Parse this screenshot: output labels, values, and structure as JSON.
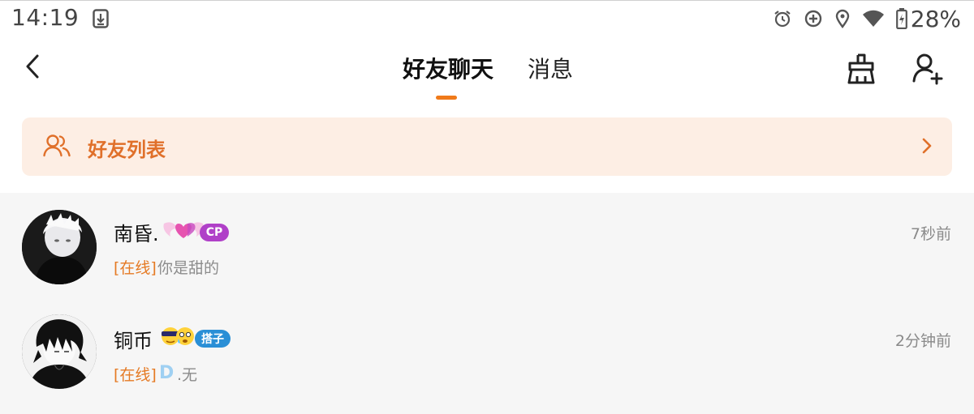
{
  "status_bar": {
    "time": "14:19",
    "battery": "28%",
    "icons": [
      "download-icon",
      "alarm-icon",
      "data-saver-icon",
      "location-icon",
      "wifi-icon",
      "battery-icon"
    ]
  },
  "header": {
    "tab_active": "好友聊天",
    "tab_inactive": "消息",
    "accent_color": "#f07a1a",
    "icons": [
      "back-arrow-icon",
      "clean-broom-icon",
      "add-friend-icon"
    ]
  },
  "friend_list_bar": {
    "label": "好友列表",
    "icon": "people-icon",
    "bg_color": "#fdeee4",
    "text_color": "#e0702a"
  },
  "conversations": [
    {
      "name": "南昏.",
      "badge": "CP",
      "time": "7秒前",
      "status": "[在线]",
      "preview": "你是甜的"
    },
    {
      "name": "铜币",
      "badge": "搭子",
      "time": "2分钟前",
      "status": "[在线]",
      "preview_prefix": "D",
      "preview": ".无"
    }
  ]
}
